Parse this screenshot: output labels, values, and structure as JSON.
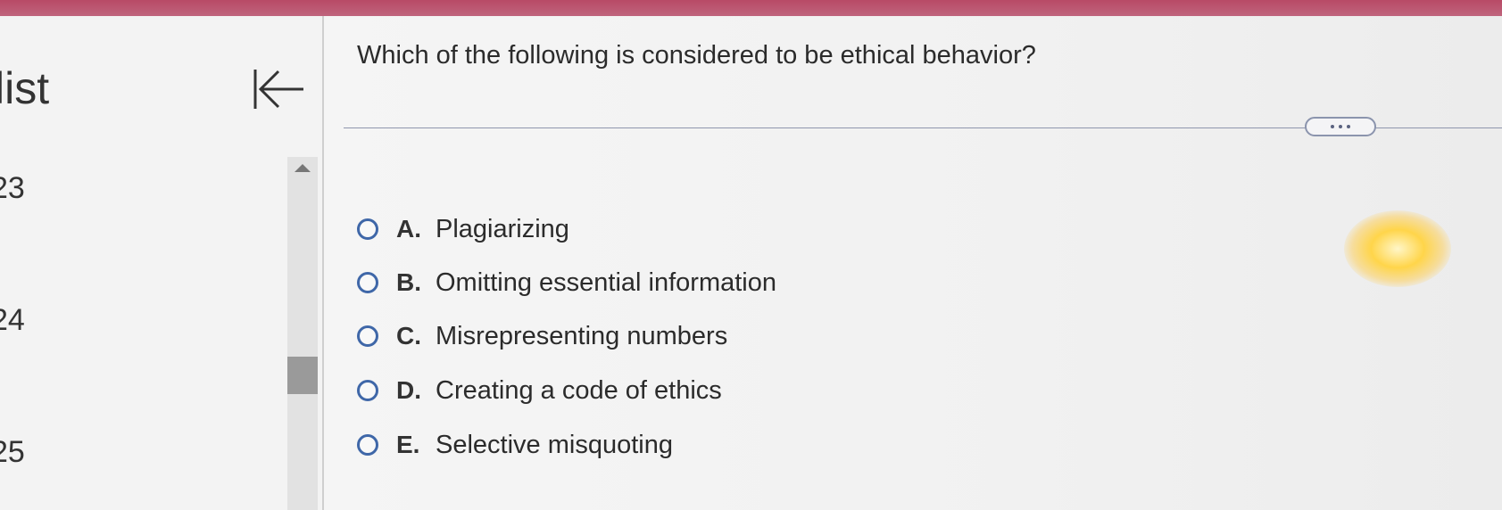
{
  "sidebar": {
    "title": "list",
    "question_numbers": [
      "23",
      "24",
      "25"
    ],
    "collapse_icon": "collapse-left-arrow-icon"
  },
  "question": {
    "text": "Which of the following is considered to be ethical behavior?",
    "more_icon": "ellipsis-icon",
    "options": [
      {
        "letter": "A.",
        "text": "Plagiarizing"
      },
      {
        "letter": "B.",
        "text": "Omitting essential information"
      },
      {
        "letter": "C.",
        "text": "Misrepresenting numbers"
      },
      {
        "letter": "D.",
        "text": "Creating a code of ethics"
      },
      {
        "letter": "E.",
        "text": "Selective misquoting"
      }
    ]
  },
  "colors": {
    "top_bar": "#b84a66",
    "radio_border": "#3f67a8",
    "divider": "#8f96ad"
  }
}
